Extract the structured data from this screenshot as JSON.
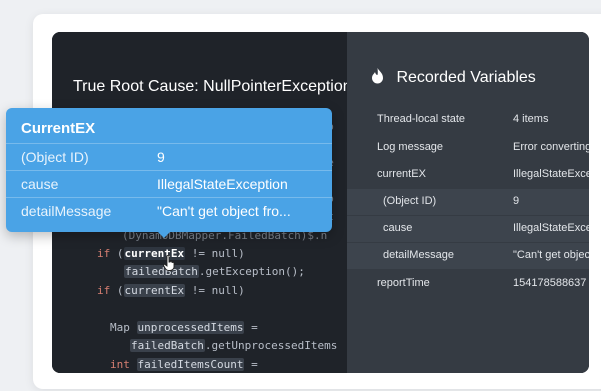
{
  "root_cause": {
    "title": "True Root Cause: NullPointerException"
  },
  "code": {
    "lines": [
      "          amo",
      "          ele",
      "          ero",
      "          Bat",
      "    (DynamoDBMapper.FailedBatch)$.n",
      "if (currentEx != null)",
      "  failedBatch.getException();",
      "if (currentEx != null)",
      "  Map unprocessedItems =",
      "    failedBatch.getUnprocessedItems",
      "  int failedItemsCount ="
    ]
  },
  "recorded_variables": {
    "title": "Recorded Variables",
    "icon": "flame-icon",
    "rows": [
      {
        "key": "Thread-local state",
        "value": "4 items"
      },
      {
        "key": "Log message",
        "value": "Error converting"
      },
      {
        "key": "currentEX",
        "value": "IllegalStateExce"
      },
      {
        "key": "(Object ID)",
        "value": "9"
      },
      {
        "key": "cause",
        "value": "IllegalStateExce"
      },
      {
        "key": "detailMessage",
        "value": "\"Can't get objec"
      },
      {
        "key": "reportTime",
        "value": "154178588637"
      }
    ]
  },
  "tooltip": {
    "title": "CurrentEX",
    "rows": [
      {
        "key": "(Object ID)",
        "value": "9"
      },
      {
        "key": "cause",
        "value": "IllegalStateException"
      },
      {
        "key": "detailMessage",
        "value": "\"Can't get object fro..."
      }
    ]
  },
  "colors": {
    "tooltip": "#4aa3e6",
    "panel": "#21252b",
    "variables_pane": "#353b43"
  }
}
